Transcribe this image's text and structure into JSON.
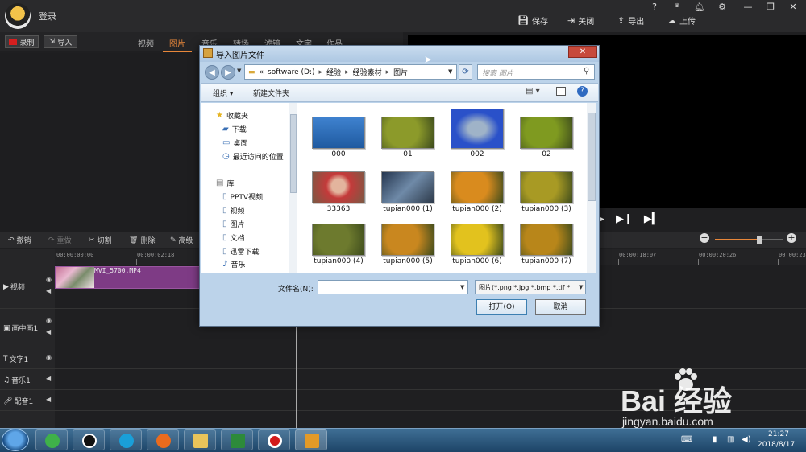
{
  "app": {
    "login": "登录",
    "actions": {
      "save": "保存",
      "close": "关闭",
      "export": "导出",
      "upload": "上传"
    },
    "window_buttons": {
      "help": "?",
      "vip": "VIP"
    }
  },
  "toolbar": {
    "record": "录制",
    "import": "导入",
    "tabs": [
      "视频",
      "图片",
      "音乐",
      "转场",
      "滤镜",
      "文字",
      "作品"
    ],
    "active_tab": "图片"
  },
  "edit_bar": {
    "undo": "撤销",
    "redo": "重做",
    "cut": "切割",
    "delete": "删除",
    "advanced": "高级"
  },
  "timeline": {
    "ruler": [
      "00:00:00:00",
      "00:00:02:18",
      "00:00:18:07",
      "00:00:20:26",
      "00:00:23"
    ],
    "tracks": [
      "视频",
      "画中画1",
      "文字1",
      "音乐1",
      "配音1"
    ],
    "clip_name": "MVI_5700.MP4"
  },
  "dialog": {
    "title": "导入图片文件",
    "close": "✕",
    "address": {
      "prefix": "«",
      "parts": [
        "software (D:)",
        "经验",
        "经验素材",
        "图片"
      ]
    },
    "search_placeholder": "搜索 图片",
    "commands": {
      "organize": "组织 ▾",
      "new_folder": "新建文件夹",
      "help": "?"
    },
    "nav_items": [
      {
        "label": "收藏夹",
        "icon": "star"
      },
      {
        "label": "下载",
        "icon": "folder"
      },
      {
        "label": "桌面",
        "icon": "desktop"
      },
      {
        "label": "最近访问的位置",
        "icon": "recent"
      },
      {
        "label": "库",
        "icon": "library"
      },
      {
        "label": "PPTV视频",
        "icon": "doc"
      },
      {
        "label": "视频",
        "icon": "doc"
      },
      {
        "label": "图片",
        "icon": "doc"
      },
      {
        "label": "文档",
        "icon": "doc"
      },
      {
        "label": "迅雷下载",
        "icon": "doc"
      },
      {
        "label": "音乐",
        "icon": "music"
      }
    ],
    "files": [
      {
        "name": "000",
        "color": "#2f6db4"
      },
      {
        "name": "01",
        "color": "#8c9a2a"
      },
      {
        "name": "002",
        "color": "#2a51c9"
      },
      {
        "name": "02",
        "color": "#7f9a20"
      },
      {
        "name": "33363",
        "color": "#b06b5a"
      },
      {
        "name": "tupian000 (1)",
        "color": "#3a4e68"
      },
      {
        "name": "tupian000 (2)",
        "color": "#d98b1e"
      },
      {
        "name": "tupian000 (3)",
        "color": "#a89a24"
      },
      {
        "name": "tupian000 (4)",
        "color": "#6d7a2e"
      },
      {
        "name": "tupian000 (5)",
        "color": "#c9871f"
      },
      {
        "name": "tupian000 (6)",
        "color": "#e2c21e"
      },
      {
        "name": "tupian000 (7)",
        "color": "#b8861a"
      }
    ],
    "filename_label": "文件名(N):",
    "filename_value": "",
    "filter": "图片(*.png *.jpg *.bmp *.tif *.",
    "open": "打开(O)",
    "cancel": "取消"
  },
  "taskbar": {
    "time": "21:27",
    "date": "2018/8/17"
  },
  "watermark": {
    "text": "Bai 经验",
    "url": "jingyan.baidu.com"
  }
}
